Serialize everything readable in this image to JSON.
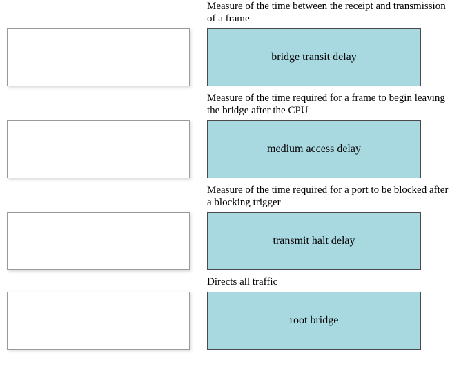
{
  "items": [
    {
      "definition": "Measure of the time between the receipt and transmission of a frame",
      "term": "bridge transit delay"
    },
    {
      "definition": "Measure of the time required for a frame to begin leaving the bridge after the CPU",
      "term": "medium access delay"
    },
    {
      "definition": "Measure of the time required for a port to be blocked after a blocking trigger",
      "term": "transmit halt delay"
    },
    {
      "definition": "Directs all traffic",
      "term": "root bridge"
    }
  ]
}
